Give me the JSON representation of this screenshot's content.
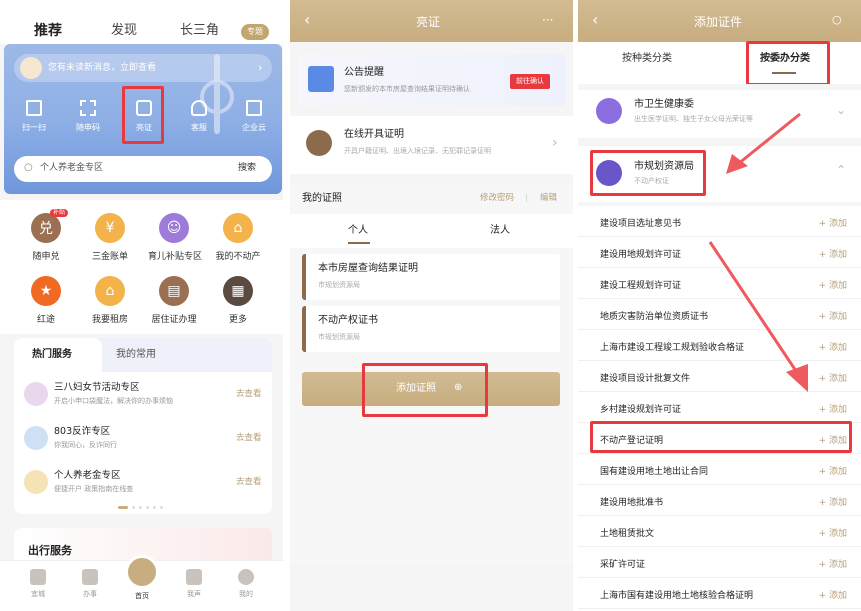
{
  "screen1": {
    "tabs": [
      "推荐",
      "发现",
      "长三角"
    ],
    "tab_badge": "专题",
    "notice": "您有未读新消息，立即查看",
    "quick_actions": [
      "扫一扫",
      "随申码",
      "亮证",
      "客服",
      "企业云"
    ],
    "search_placeholder": "个人养老金专区",
    "search_button": "搜索",
    "services": [
      "随申兑",
      "三金账单",
      "育儿补贴专区",
      "我的不动产",
      "红途",
      "我要租房",
      "居住证办理",
      "更多"
    ],
    "service_badge": "补贴",
    "hot_tabs": [
      "热门服务",
      "我的常用"
    ],
    "hot_items": [
      {
        "title": "三八妇女节活动专区",
        "desc": "开启小申口袋魔法，解决你的办事烦恼",
        "action": "去查看"
      },
      {
        "title": "803反诈专区",
        "desc": "你我同心，反诈同行",
        "action": "去查看"
      },
      {
        "title": "个人养老金专区",
        "desc": "便捷开户 政策指南在线查",
        "action": "去查看"
      }
    ],
    "travel_title": "出行服务",
    "nav": [
      "宜城",
      "办事",
      "首页",
      "我声",
      "我的"
    ]
  },
  "screen2": {
    "title": "亮证",
    "more_icon": "···",
    "notice_title": "公告提醒",
    "notice_desc": "您新颁发的本市房屋查询结果证明待确认",
    "notice_button": "前往确认",
    "online_title": "在线开具证明",
    "online_desc": "开具户籍证明、出境入境记录、无犯罪记录证明",
    "mycert_label": "我的证照",
    "mycert_actions": [
      "修改密码",
      "编辑"
    ],
    "tabs": [
      "个人",
      "法人"
    ],
    "certs": [
      {
        "name": "本市房屋查询结果证明",
        "org": "市规划资源局"
      },
      {
        "name": "不动产权证书",
        "org": "市规划资源局"
      }
    ],
    "add_button": "添加证照"
  },
  "screen3": {
    "title": "添加证件",
    "tabs": [
      "按种类分类",
      "按委办分类"
    ],
    "dept1": {
      "name": "市卫生健康委",
      "desc": "出生医学证明、独生子女父母光荣证等"
    },
    "dept2": {
      "name": "市规划资源局",
      "desc": "不动产权证"
    },
    "add_label": "+ 添加",
    "items": [
      "建设项目选址意见书",
      "建设用地规划许可证",
      "建设工程规划许可证",
      "地质灾害防治单位资质证书",
      "上海市建设工程竣工规划验收合格证",
      "建设项目设计批复文件",
      "乡村建设规划许可证",
      "不动产登记证明",
      "国有建设用地土地出让合同",
      "建设用地批准书",
      "土地租赁批文",
      "采矿许可证",
      "上海市国有建设用地土地核验合格证明"
    ]
  },
  "colors": {
    "gold": "#c7ad7f",
    "red": "#e8393f",
    "brown": "#8c6b4d"
  }
}
